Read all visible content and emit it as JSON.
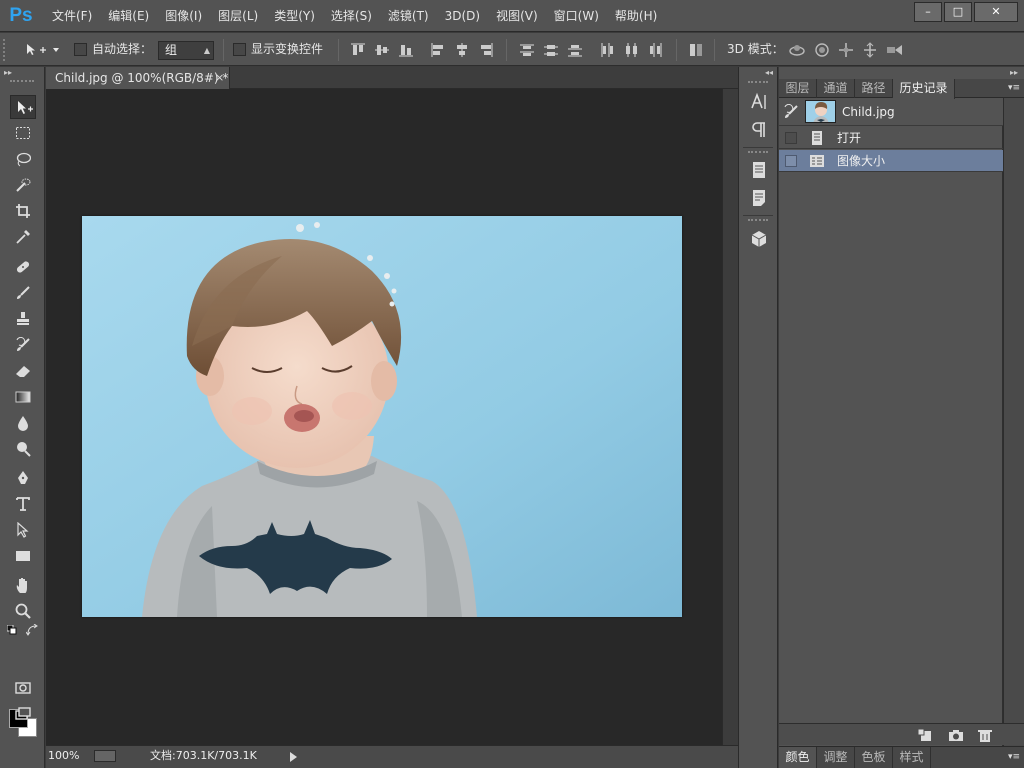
{
  "app": {
    "logo": "Ps"
  },
  "menu": [
    "文件(F)",
    "编辑(E)",
    "图像(I)",
    "图层(L)",
    "类型(Y)",
    "选择(S)",
    "滤镜(T)",
    "3D(D)",
    "视图(V)",
    "窗口(W)",
    "帮助(H)"
  ],
  "window_controls": {
    "minimize": "–",
    "maximize": "□",
    "close": "✕"
  },
  "options": {
    "auto_select_label": "自动选择：",
    "auto_select_checked": false,
    "auto_select_value": "组",
    "show_transform_label": "显示变换控件",
    "show_transform_checked": false,
    "mode_3d_label": "3D 模式："
  },
  "document": {
    "tab_title": "Child.jpg @ 100%(RGB/8#) *",
    "tab_close": "×",
    "zoom": "100%",
    "doc_info": "文档:703.1K/703.1K"
  },
  "panels": {
    "tabs": [
      "图层",
      "通道",
      "路径",
      "历史记录"
    ],
    "active_tab": "历史记录",
    "history": {
      "snapshot_name": "Child.jpg",
      "items": [
        {
          "label": "打开",
          "icon": "document-icon",
          "selected": false
        },
        {
          "label": "图像大小",
          "icon": "image-size-icon",
          "selected": true
        }
      ]
    },
    "bottom_tabs": [
      "颜色",
      "调整",
      "色板",
      "样式"
    ],
    "bottom_active": "颜色"
  },
  "colors": {
    "foreground": "#000000",
    "background": "#ffffff",
    "selection": "#6c7e9c",
    "ps_blue": "#2fa3f0"
  },
  "tools": [
    "move-tool",
    "marquee-tool",
    "lasso-tool",
    "quick-select-tool",
    "crop-tool",
    "eyedropper-tool",
    "healing-brush-tool",
    "brush-tool",
    "clone-stamp-tool",
    "history-brush-tool",
    "eraser-tool",
    "gradient-tool",
    "blur-tool",
    "dodge-tool",
    "pen-tool",
    "type-tool",
    "path-select-tool",
    "rectangle-tool",
    "hand-tool",
    "zoom-tool"
  ]
}
